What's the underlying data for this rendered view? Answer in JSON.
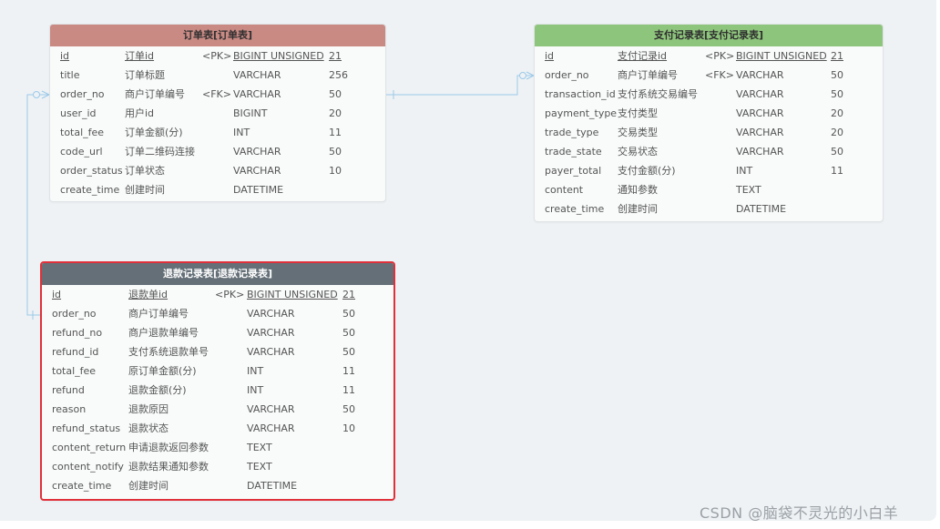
{
  "tables": {
    "orders": {
      "title": "订单表[订单表]",
      "header_color": "#c98a84",
      "rows": [
        {
          "name": "id",
          "comment": "订单id",
          "key": "<PK>",
          "type": "BIGINT UNSIGNED",
          "length": "21",
          "is_pk": true
        },
        {
          "name": "title",
          "comment": "订单标题",
          "key": "",
          "type": "VARCHAR",
          "length": "256"
        },
        {
          "name": "order_no",
          "comment": "商户订单编号",
          "key": "<FK>",
          "type": "VARCHAR",
          "length": "50"
        },
        {
          "name": "user_id",
          "comment": "用户id",
          "key": "",
          "type": "BIGINT",
          "length": "20"
        },
        {
          "name": "total_fee",
          "comment": "订单金额(分)",
          "key": "",
          "type": "INT",
          "length": "11"
        },
        {
          "name": "code_url",
          "comment": "订单二维码连接",
          "key": "",
          "type": "VARCHAR",
          "length": "50"
        },
        {
          "name": "order_status",
          "comment": "订单状态",
          "key": "",
          "type": "VARCHAR",
          "length": "10"
        },
        {
          "name": "create_time",
          "comment": "创建时间",
          "key": "",
          "type": "DATETIME",
          "length": ""
        }
      ]
    },
    "payments": {
      "title": "支付记录表[支付记录表]",
      "header_color": "#8ec57c",
      "rows": [
        {
          "name": "id",
          "comment": "支付记录id",
          "key": "<PK>",
          "type": "BIGINT UNSIGNED",
          "length": "21",
          "is_pk": true
        },
        {
          "name": "order_no",
          "comment": "商户订单编号",
          "key": "<FK>",
          "type": "VARCHAR",
          "length": "50"
        },
        {
          "name": "transaction_id",
          "comment": "支付系统交易编号",
          "key": "",
          "type": "VARCHAR",
          "length": "50"
        },
        {
          "name": "payment_type",
          "comment": "支付类型",
          "key": "",
          "type": "VARCHAR",
          "length": "20"
        },
        {
          "name": "trade_type",
          "comment": "交易类型",
          "key": "",
          "type": "VARCHAR",
          "length": "20"
        },
        {
          "name": "trade_state",
          "comment": "交易状态",
          "key": "",
          "type": "VARCHAR",
          "length": "50"
        },
        {
          "name": "payer_total",
          "comment": "支付金额(分)",
          "key": "",
          "type": "INT",
          "length": "11"
        },
        {
          "name": "content",
          "comment": "通知参数",
          "key": "",
          "type": "TEXT",
          "length": ""
        },
        {
          "name": "create_time",
          "comment": "创建时间",
          "key": "",
          "type": "DATETIME",
          "length": ""
        }
      ]
    },
    "refunds": {
      "title": "退款记录表[退款记录表]",
      "header_color": "#646f77",
      "rows": [
        {
          "name": "id",
          "comment": "退款单id",
          "key": "<PK>",
          "type": "BIGINT UNSIGNED",
          "length": "21",
          "is_pk": true
        },
        {
          "name": "order_no",
          "comment": "商户订单编号",
          "key": "",
          "type": "VARCHAR",
          "length": "50"
        },
        {
          "name": "refund_no",
          "comment": "商户退款单编号",
          "key": "",
          "type": "VARCHAR",
          "length": "50"
        },
        {
          "name": "refund_id",
          "comment": "支付系统退款单号",
          "key": "",
          "type": "VARCHAR",
          "length": "50"
        },
        {
          "name": "total_fee",
          "comment": "原订单金额(分)",
          "key": "",
          "type": "INT",
          "length": "11"
        },
        {
          "name": "refund",
          "comment": "退款金额(分)",
          "key": "",
          "type": "INT",
          "length": "11"
        },
        {
          "name": "reason",
          "comment": "退款原因",
          "key": "",
          "type": "VARCHAR",
          "length": "50"
        },
        {
          "name": "refund_status",
          "comment": "退款状态",
          "key": "",
          "type": "VARCHAR",
          "length": "10"
        },
        {
          "name": "content_return",
          "comment": "申请退款返回参数",
          "key": "",
          "type": "TEXT",
          "length": ""
        },
        {
          "name": "content_notify",
          "comment": "退款结果通知参数",
          "key": "",
          "type": "TEXT",
          "length": ""
        },
        {
          "name": "create_time",
          "comment": "创建时间",
          "key": "",
          "type": "DATETIME",
          "length": ""
        }
      ]
    }
  },
  "connector_color": "#9cc9ea",
  "watermark": "CSDN @脑袋不灵光的小白羊"
}
